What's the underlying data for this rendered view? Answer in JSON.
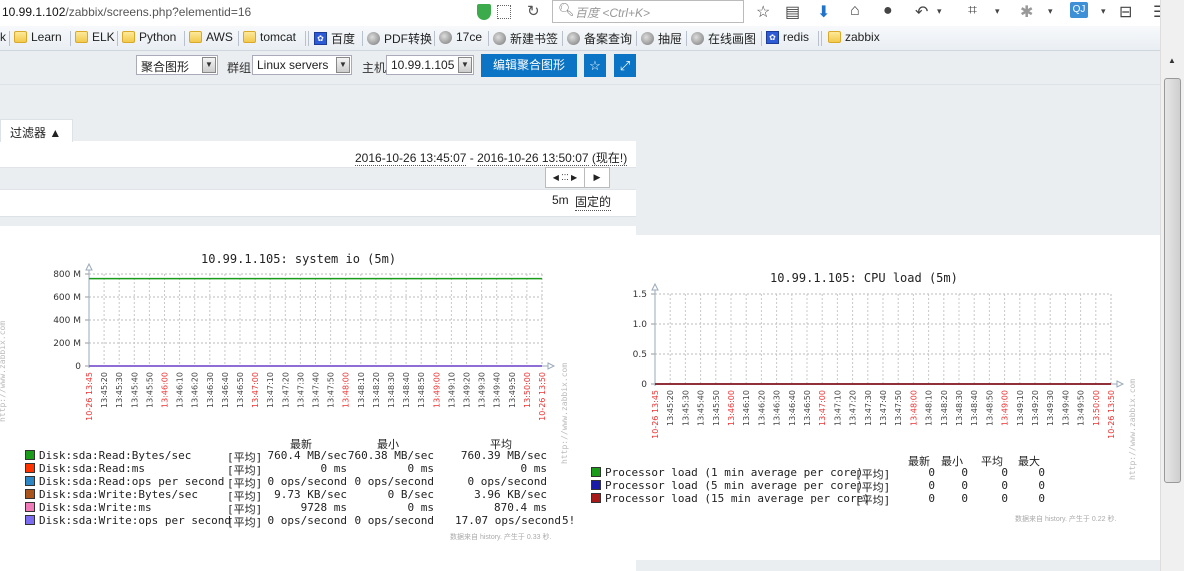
{
  "browser": {
    "url_host": "10.99.1.102",
    "url_path": "/zabbix/screens.php?elementid=16",
    "search_placeholder": "百度 <Ctrl+K>",
    "toolbar_icons": [
      "star-icon",
      "reading-list-icon",
      "download-icon",
      "home-icon",
      "chat-icon",
      "undo-icon",
      "crop-icon",
      "bug-icon",
      "profile-icon",
      "train-icon",
      "menu-icon"
    ],
    "bookmarks": [
      {
        "label": "Learn",
        "icon": "folder-icon"
      },
      {
        "label": "ELK",
        "icon": "folder-icon"
      },
      {
        "label": "Python",
        "icon": "folder-icon"
      },
      {
        "label": "AWS",
        "icon": "folder-icon"
      },
      {
        "label": "tomcat",
        "icon": "folder-icon"
      },
      {
        "label": "百度",
        "icon": "baidu-paw-icon"
      },
      {
        "label": "PDF转换",
        "icon": "globe-icon"
      },
      {
        "label": "17ce",
        "icon": "globe-icon"
      },
      {
        "label": "新建书签",
        "icon": "globe-icon"
      },
      {
        "label": "备案查询",
        "icon": "globe-icon"
      },
      {
        "label": "抽屉",
        "icon": "globe-icon"
      },
      {
        "label": "在线画图",
        "icon": "globe-icon"
      },
      {
        "label": "redis",
        "icon": "baidu-paw-icon"
      },
      {
        "label": "zabbix",
        "icon": "folder-icon"
      }
    ]
  },
  "header": {
    "screen_select": "聚合图形",
    "group_label": "群组",
    "group_select": "Linux servers",
    "host_label": "主机",
    "host_select": "10.99.1.105",
    "edit_button": "编辑聚合图形",
    "favorite_icon": "☆",
    "fullscreen_icon": "⤢"
  },
  "filter": {
    "tab_label": "过滤器 ▲",
    "range_from": "2016-10-26 13:45:07",
    "range_sep": " - ",
    "range_to": "2016-10-26 13:50:07",
    "now_label": "(现在!)",
    "nav_left": "◀ ⁚⁚⁚ ▶",
    "nav_right": "▶",
    "period": "5m",
    "fixed_label": "固定的"
  },
  "chart_data": [
    {
      "type": "line",
      "title": "10.99.1.105: system io (5m)",
      "ylim": [
        0,
        800
      ],
      "yticks": [
        "0",
        "200 M",
        "400 M",
        "600 M",
        "800 M"
      ],
      "ytick_values": [
        0,
        200,
        400,
        600,
        800
      ],
      "xticks": [
        "10-26 13:45",
        "13:45:20",
        "13:45:30",
        "13:45:40",
        "13:45:50",
        "13:46:00",
        "13:46:10",
        "13:46:20",
        "13:46:30",
        "13:46:40",
        "13:46:50",
        "13:47:00",
        "13:47:10",
        "13:47:20",
        "13:47:30",
        "13:47:40",
        "13:47:50",
        "13:48:00",
        "13:48:10",
        "13:48:20",
        "13:48:30",
        "13:48:40",
        "13:48:50",
        "13:49:00",
        "13:49:10",
        "13:49:20",
        "13:49:30",
        "13:49:40",
        "13:49:50",
        "13:50:00",
        "10-26 13:50"
      ],
      "xtick_red": [
        0,
        5,
        11,
        17,
        23,
        29,
        30
      ],
      "grid": true,
      "series": [
        {
          "name": "Disk:sda:Read:Bytes/sec",
          "color": "#1a9b1a",
          "value_m": 760
        },
        {
          "name": "Disk:sda:Read:ms",
          "color": "#ff3300",
          "value_m": 0
        },
        {
          "name": "Disk:sda:Read:ops per second",
          "color": "#2c86c4",
          "value_m": 0
        },
        {
          "name": "Disk:sda:Write:Bytes/sec",
          "color": "#a8541a",
          "value_m": 0
        },
        {
          "name": "Disk:sda:Write:ms",
          "color": "#ef7cb8",
          "value_m": 0
        },
        {
          "name": "Disk:sda:Write:ops per second",
          "color": "#7c6cf0",
          "value_m": 0
        }
      ],
      "legend_headers": [
        "最新",
        "最小",
        "平均"
      ],
      "legend_func": "[平均]",
      "legend_rows": [
        [
          "760.4 MB/sec",
          "760.38 MB/sec",
          "760.39 MB/sec"
        ],
        [
          "0 ms",
          "0 ms",
          "0 ms"
        ],
        [
          "0 ops/second",
          "0 ops/second",
          "0 ops/second"
        ],
        [
          "9.73 KB/sec",
          "0 B/sec",
          "3.96 KB/sec"
        ],
        [
          "9728 ms",
          "0 ms",
          "870.4 ms"
        ],
        [
          "0 ops/second",
          "0 ops/second",
          "17.07 ops/second"
        ]
      ],
      "overflow_text": "5!",
      "footer": "数据来自 history. 产生于 0.33 秒.",
      "watermark": "http://www.zabbix.com"
    },
    {
      "type": "line",
      "title": "10.99.1.105: CPU load (5m)",
      "ylim": [
        0,
        1.5
      ],
      "yticks": [
        "0",
        "0.5",
        "1.0",
        "1.5"
      ],
      "ytick_values": [
        0,
        0.5,
        1.0,
        1.5
      ],
      "xticks": [
        "10-26 13:45",
        "13:45:20",
        "13:45:30",
        "13:45:40",
        "13:45:50",
        "13:46:00",
        "13:46:10",
        "13:46:20",
        "13:46:30",
        "13:46:40",
        "13:46:50",
        "13:47:00",
        "13:47:10",
        "13:47:20",
        "13:47:30",
        "13:47:40",
        "13:47:50",
        "13:48:00",
        "13:48:10",
        "13:48:20",
        "13:48:30",
        "13:48:40",
        "13:48:50",
        "13:49:00",
        "13:49:10",
        "13:49:20",
        "13:49:30",
        "13:49:40",
        "13:49:50",
        "13:50:00",
        "10-26 13:50"
      ],
      "xtick_red": [
        0,
        5,
        11,
        17,
        23,
        29,
        30
      ],
      "grid": true,
      "series": [
        {
          "name": "Processor load (1 min average per core)",
          "color": "#1a9b1a",
          "value": 0
        },
        {
          "name": "Processor load (5 min average per core)",
          "color": "#1a1aa8",
          "value": 0
        },
        {
          "name": "Processor load (15 min average per core)",
          "color": "#a81a1a",
          "value": 0
        }
      ],
      "legend_headers": [
        "最新",
        "最小",
        "平均",
        "最大"
      ],
      "legend_func": "[平均]",
      "legend_rows": [
        [
          "0",
          "0",
          "0",
          "0"
        ],
        [
          "0",
          "0",
          "0",
          "0"
        ],
        [
          "0",
          "0",
          "0",
          "0"
        ]
      ],
      "footer": "数据来自 history. 产生于 0.22 秒.",
      "watermark": "http://www.zabbix.com"
    }
  ]
}
